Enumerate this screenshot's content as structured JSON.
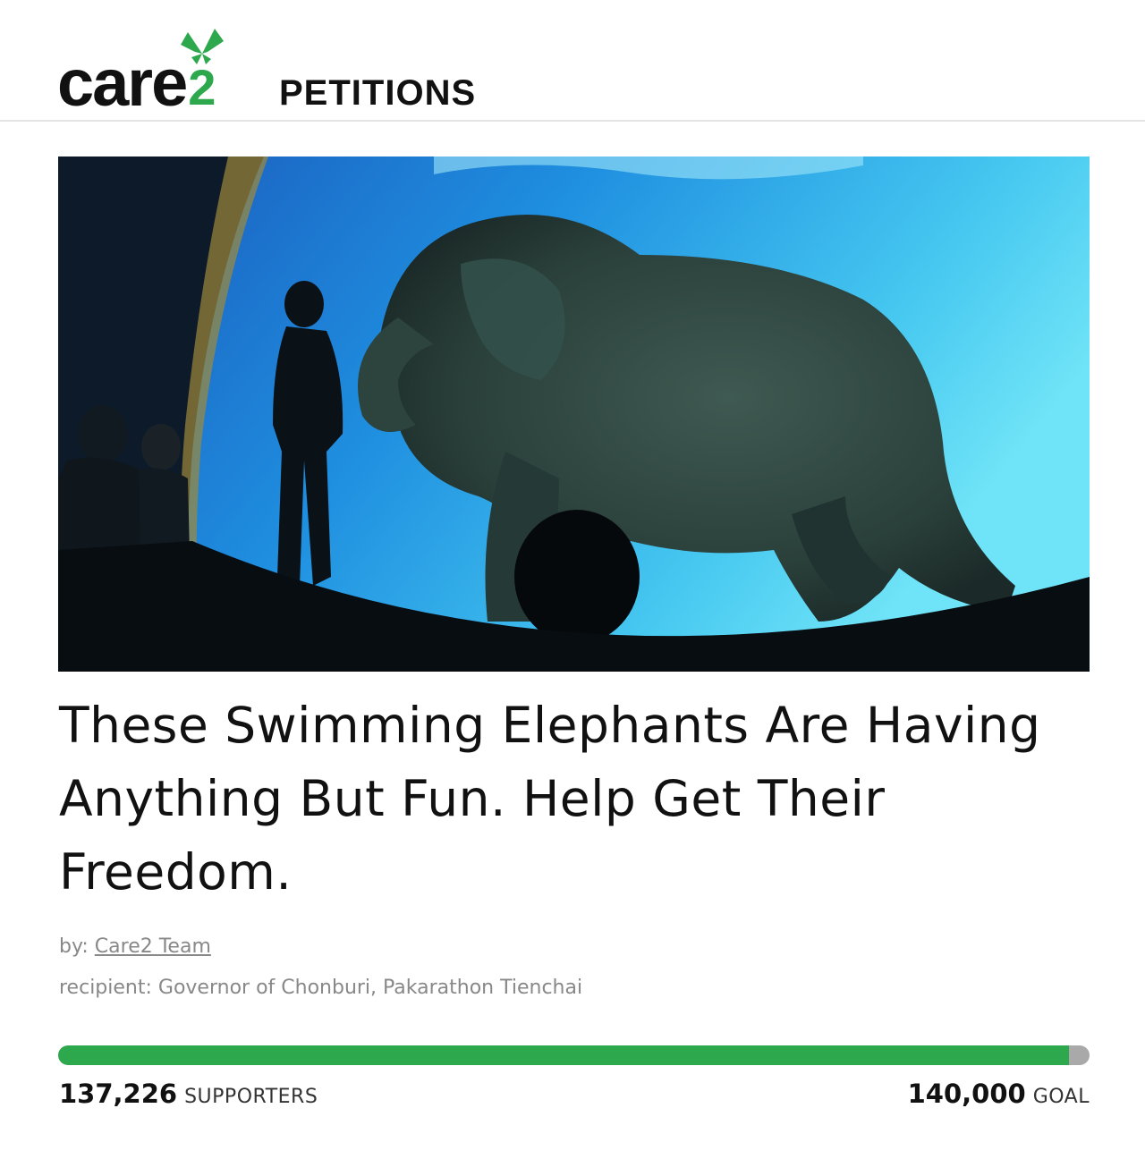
{
  "header": {
    "logo_word": "care",
    "logo_number": "2",
    "section_label": "PETITIONS"
  },
  "hero": {
    "icon": "elephant-aquarium-photo"
  },
  "petition": {
    "title": "These Swimming Elephants Are Having Anything But Fun. Help Get Their Freedom.",
    "by_label": "by:",
    "author": "Care2 Team",
    "recipient_label": "recipient:",
    "recipient": "Governor of Chonburi, Pakarathon Tienchai"
  },
  "progress": {
    "supporters_count": "137,226",
    "supporters_label": "SUPPORTERS",
    "goal_count": "140,000",
    "goal_label": "GOAL",
    "fraction": 0.98
  },
  "colors": {
    "brand_green": "#2ea84d",
    "track_gray": "#a9a9a9",
    "meta_gray": "#888888"
  }
}
